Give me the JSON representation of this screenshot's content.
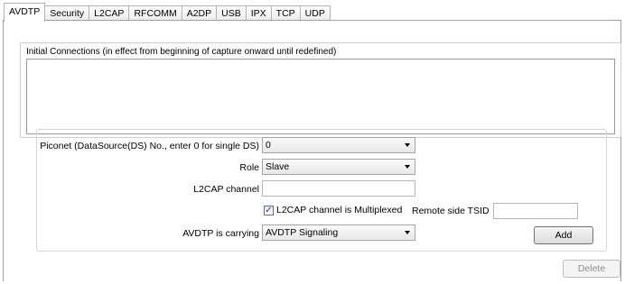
{
  "tabs": [
    {
      "label": "AVDTP",
      "active": true
    },
    {
      "label": "Security"
    },
    {
      "label": "L2CAP"
    },
    {
      "label": "RFCOMM"
    },
    {
      "label": "A2DP"
    },
    {
      "label": "USB"
    },
    {
      "label": "IPX"
    },
    {
      "label": "TCP"
    },
    {
      "label": "UDP"
    }
  ],
  "initial_connections": {
    "label": "Initial Connections (in effect from beginning of capture onward until redefined)",
    "text": ""
  },
  "form": {
    "piconet_label": "Piconet (DataSource(DS) No., enter 0 for single DS)",
    "piconet_value": "0",
    "role_label": "Role",
    "role_value": "Slave",
    "l2cap_channel_label": "L2CAP channel",
    "l2cap_channel_value": "",
    "multiplexed_label": "L2CAP channel is Multiplexed",
    "multiplexed_checked": true,
    "remote_tsid_label": "Remote side TSID",
    "remote_tsid_value": "",
    "carrying_label": "AVDTP is carrying",
    "carrying_value": "AVDTP Signaling",
    "add_label": "Add"
  },
  "delete_label": "Delete"
}
